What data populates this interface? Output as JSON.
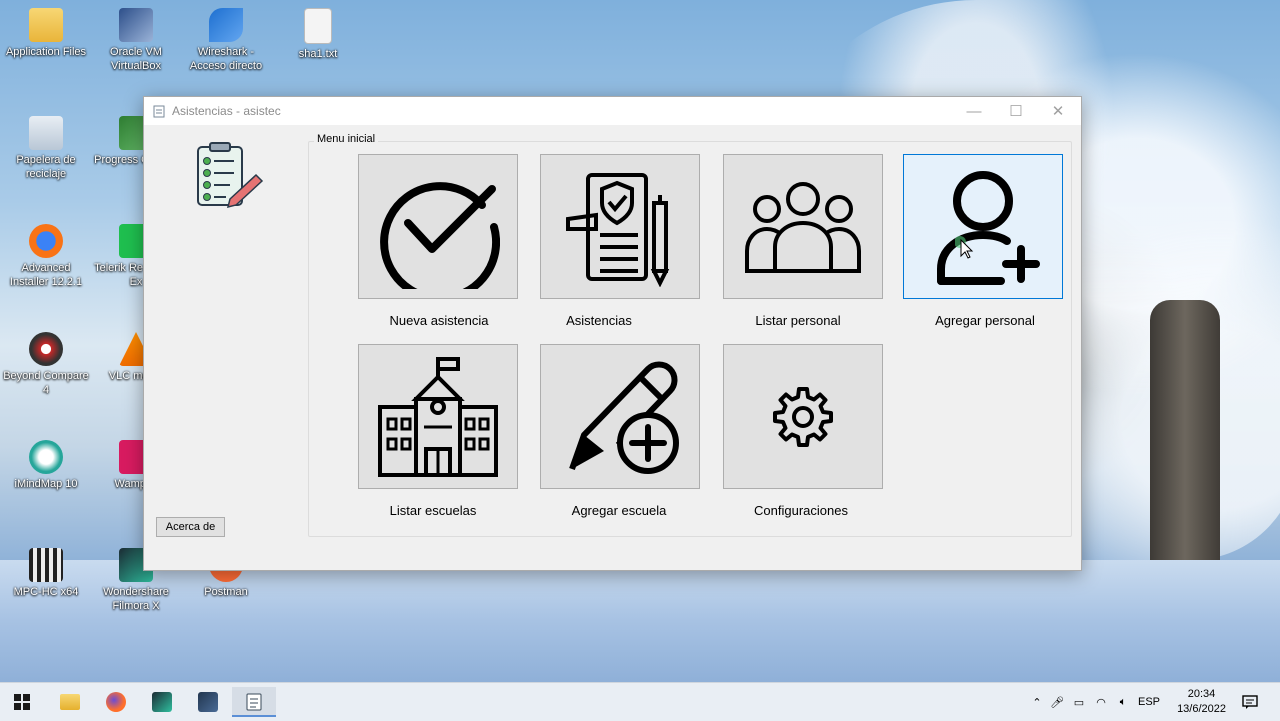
{
  "desktop": {
    "icons": [
      {
        "label": "Application Files"
      },
      {
        "label": "Oracle VM VirtualBox"
      },
      {
        "label": "Wireshark - Acceso directo"
      },
      {
        "label": "sha1.txt"
      },
      {
        "label": "Papelera de reciclaje"
      },
      {
        "label": "Progress C Pane"
      },
      {
        "label": "Advanced Installer 12.2.1"
      },
      {
        "label": "Telerik Re Online Ex"
      },
      {
        "label": "Beyond Compare 4"
      },
      {
        "label": "VLC media"
      },
      {
        "label": "iMindMap 10"
      },
      {
        "label": "Wampse"
      },
      {
        "label": "MPC-HC x64"
      },
      {
        "label": "Wondershare Filmora X"
      },
      {
        "label": "Postman"
      }
    ]
  },
  "window": {
    "title": "Asistencias - asistec",
    "minimize": "—",
    "maximize": "☐",
    "close": "✕",
    "group_label": "Menu inicial",
    "tiles": [
      {
        "label": "Nueva asistencia",
        "icon": "check-circle-icon"
      },
      {
        "label": "Asistencias",
        "icon": "document-shield-icon"
      },
      {
        "label": "Listar personal",
        "icon": "group-people-icon"
      },
      {
        "label": "Agregar personal",
        "icon": "add-user-icon"
      },
      {
        "label": "Listar escuelas",
        "icon": "school-building-icon"
      },
      {
        "label": "Agregar escuela",
        "icon": "pen-plus-icon"
      },
      {
        "label": "Configuraciones",
        "icon": "gear-icon"
      }
    ],
    "about_button": "Acerca de",
    "accent_color": "#0078d7"
  },
  "taskbar": {
    "language": "ESP",
    "time": "20:34",
    "date": "13/6/2022"
  }
}
